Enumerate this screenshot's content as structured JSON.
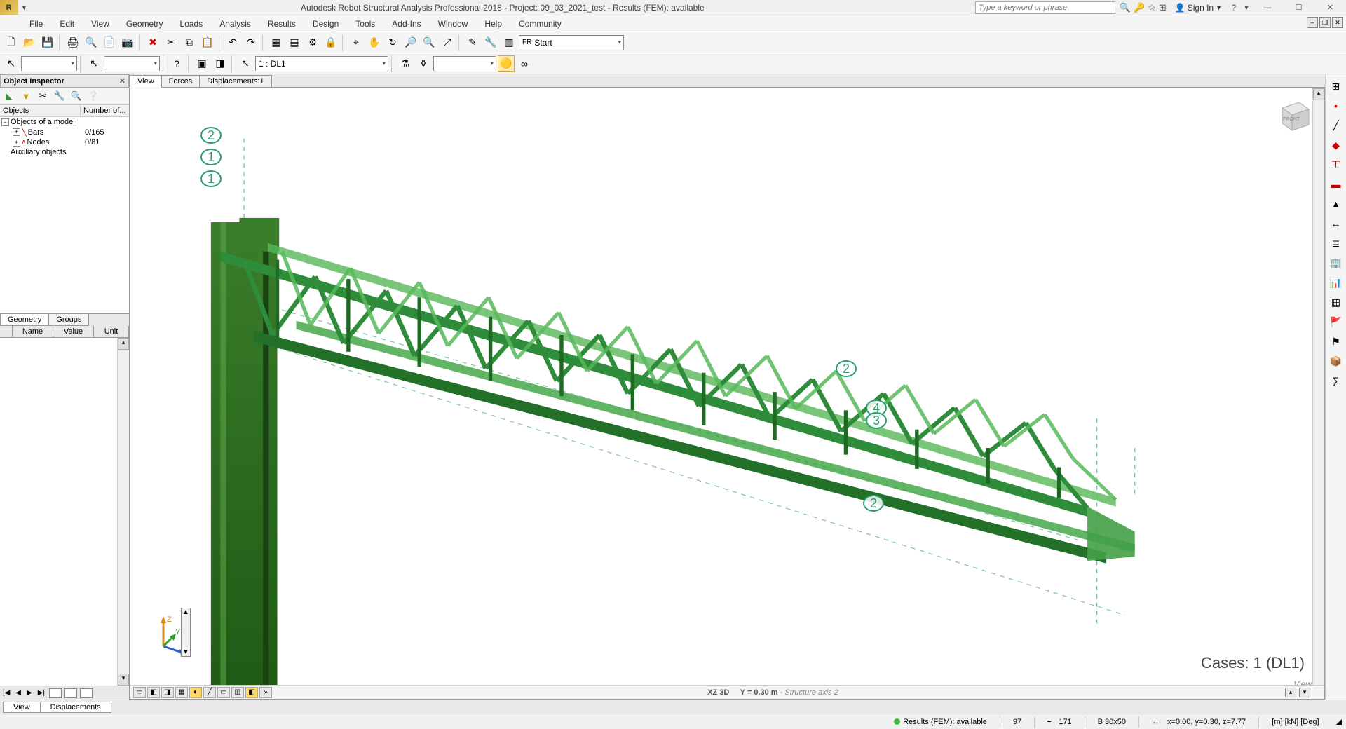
{
  "title": "Autodesk Robot Structural Analysis Professional 2018 - Project: 09_03_2021_test - Results (FEM): available",
  "search_placeholder": "Type a keyword or phrase",
  "signin": "Sign In",
  "menu": [
    "File",
    "Edit",
    "View",
    "Geometry",
    "Loads",
    "Analysis",
    "Results",
    "Design",
    "Tools",
    "Add-Ins",
    "Window",
    "Help",
    "Community"
  ],
  "layout_combo": "Start",
  "toolbar2": {
    "case_combo": "1 : DL1"
  },
  "inspector": {
    "title": "Object Inspector",
    "cols": [
      "Objects",
      "Number of..."
    ],
    "rows": [
      {
        "indent": 0,
        "exp": "-",
        "icon": "",
        "label": "Objects of a model",
        "count": ""
      },
      {
        "indent": 1,
        "exp": "+",
        "icon": "╲",
        "label": "Bars",
        "count": "0/165"
      },
      {
        "indent": 1,
        "exp": "+",
        "icon": "ʌ",
        "label": "Nodes",
        "count": "0/81"
      },
      {
        "indent": 0,
        "exp": "",
        "icon": "",
        "label": "Auxiliary objects",
        "count": ""
      }
    ],
    "tabs": [
      "Geometry",
      "Groups"
    ],
    "prop_cols": [
      "Name",
      "Value",
      "Unit"
    ]
  },
  "view": {
    "tabs": [
      "View",
      "Forces",
      "Displacements:1"
    ],
    "axis_labels_left": [
      "2",
      "1",
      "1"
    ],
    "axis_labels_right": [
      "2",
      "4",
      "3",
      "2"
    ],
    "cases": "Cases: 1 (DL1)",
    "corner_label": "View",
    "bottom_center_a": "XZ 3D",
    "bottom_center_b": "Y = 0.30 m",
    "bottom_center_c": " - Structure axis 2"
  },
  "doctabs": [
    "View",
    "Displacements"
  ],
  "status": {
    "results": "Results (FEM): available",
    "v1": "97",
    "v2": "171",
    "section": "B 30x50",
    "coords": "x=0.00, y=0.30, z=7.77",
    "units": "[m] [kN] [Deg]"
  },
  "icons": {
    "new": "🗋",
    "open": "📂",
    "save": "💾",
    "print": "🖨",
    "preview": "🔍",
    "screenshot": "📷",
    "delete": "✖",
    "cut": "✂",
    "copy": "⧉",
    "paste": "📋",
    "undo": "↶",
    "redo": "↷",
    "grid": "▦",
    "table": "▤",
    "calc": "⚙",
    "lock": "🔒",
    "zoomwin": "⌖",
    "hand": "✋",
    "rot": "↻",
    "fit": "⤢",
    "cursor": "↖",
    "wrench": "🔧",
    "layout": "▥",
    "node": "•",
    "bar": "╱",
    "section": "工",
    "mat": "▬",
    "support": "▲",
    "load": "↓",
    "dim": "↔",
    "axis": "✛",
    "layers": "≣",
    "colors": "▦",
    "results": "📊",
    "flag": "🚩",
    "flag2": "⚑",
    "cube": "📦",
    "calc2": "∑"
  }
}
